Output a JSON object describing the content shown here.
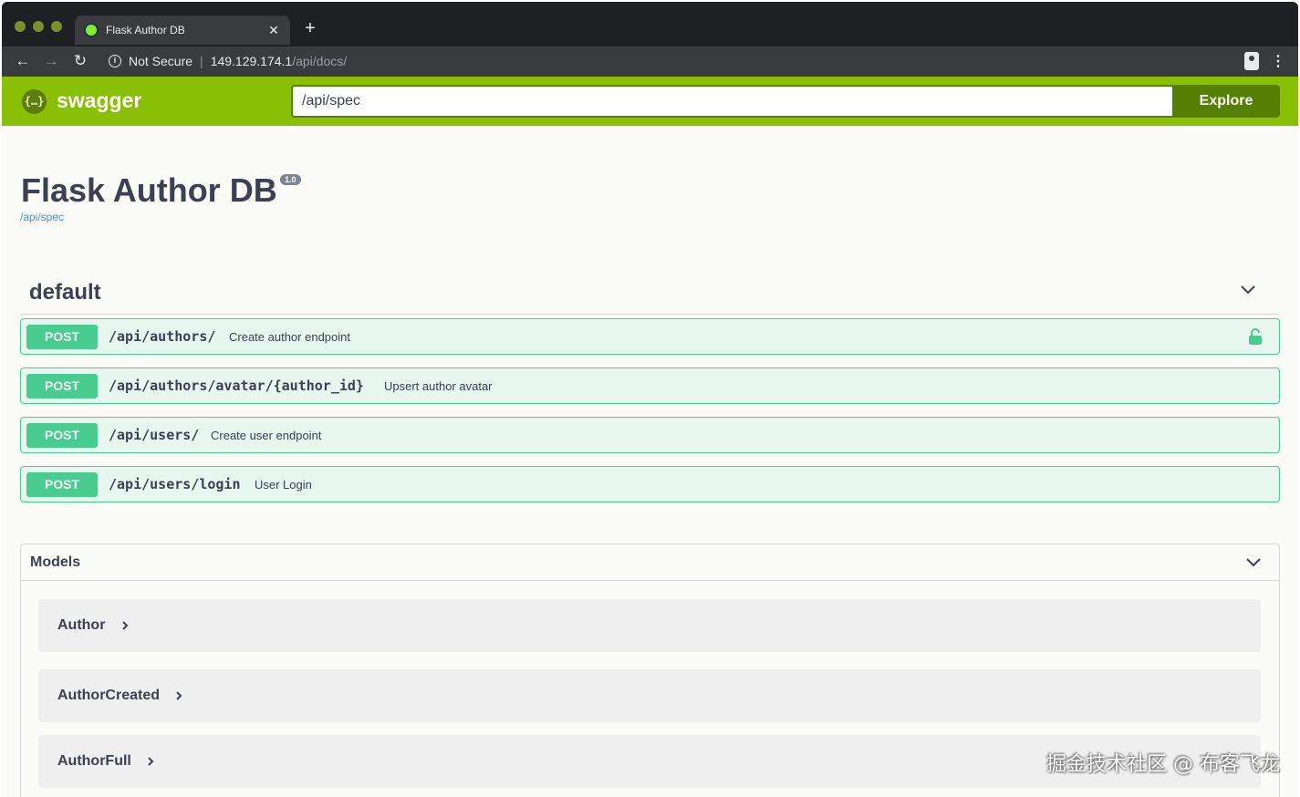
{
  "browser": {
    "tab_title": "Flask Author DB",
    "security_label": "Not Secure",
    "url_host": "149.129.174.1",
    "url_path": "/api/docs/"
  },
  "topbar": {
    "logo_text": "swagger",
    "spec_url": "/api/spec",
    "explore_label": "Explore"
  },
  "info": {
    "title": "Flask Author DB",
    "version": "1.0",
    "spec_link": "/api/spec"
  },
  "tag": {
    "name": "default",
    "operations": [
      {
        "method": "POST",
        "path": "/api/authors/",
        "description": "Create author endpoint"
      },
      {
        "method": "POST",
        "path": "/api/authors/avatar/{author_id}",
        "description": "Upsert author avatar"
      },
      {
        "method": "POST",
        "path": "/api/users/",
        "description": "Create user endpoint"
      },
      {
        "method": "POST",
        "path": "/api/users/login",
        "description": "User Login"
      }
    ]
  },
  "models": {
    "title": "Models",
    "items": [
      "Author",
      "AuthorCreated",
      "AuthorFull"
    ]
  },
  "watermark": "掘金技术社区 @ 布客飞龙",
  "colors": {
    "swagger_green": "#89bf04",
    "post_green": "#49cc90",
    "post_bg": "#e8f6f0",
    "text_dark": "#3b4151"
  }
}
